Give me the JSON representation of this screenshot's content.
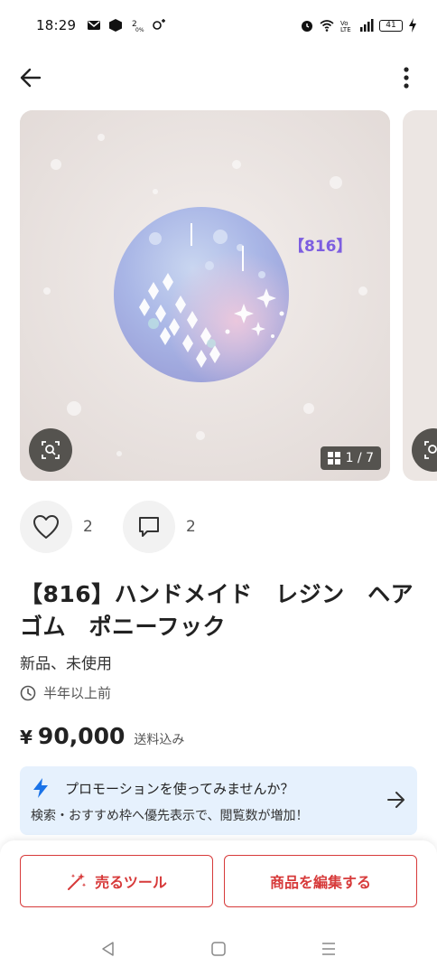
{
  "status_bar": {
    "time": "18:29",
    "battery": "41"
  },
  "product": {
    "image_label": "【816】",
    "image_counter": "1 / 7",
    "likes": "2",
    "comments": "2",
    "title": "【816】ハンドメイド　レジン　ヘアゴム　ポニーフック",
    "condition": "新品、未使用",
    "posted": "半年以上前",
    "currency": "¥",
    "price": "90,000",
    "shipping": "送料込み"
  },
  "promo": {
    "title": "プロモーションを使ってみませんか？",
    "description": "検索・おすすめ枠へ優先表示で、閲覧数が増加！"
  },
  "bottom": {
    "sell_tool_label": "売るツール",
    "edit_label": "商品を編集する"
  },
  "colors": {
    "accent_red": "#d73a3a",
    "promo_bg": "#e6f1fd",
    "promo_icon": "#1a73e8",
    "label_purple": "#7d5ee0"
  }
}
